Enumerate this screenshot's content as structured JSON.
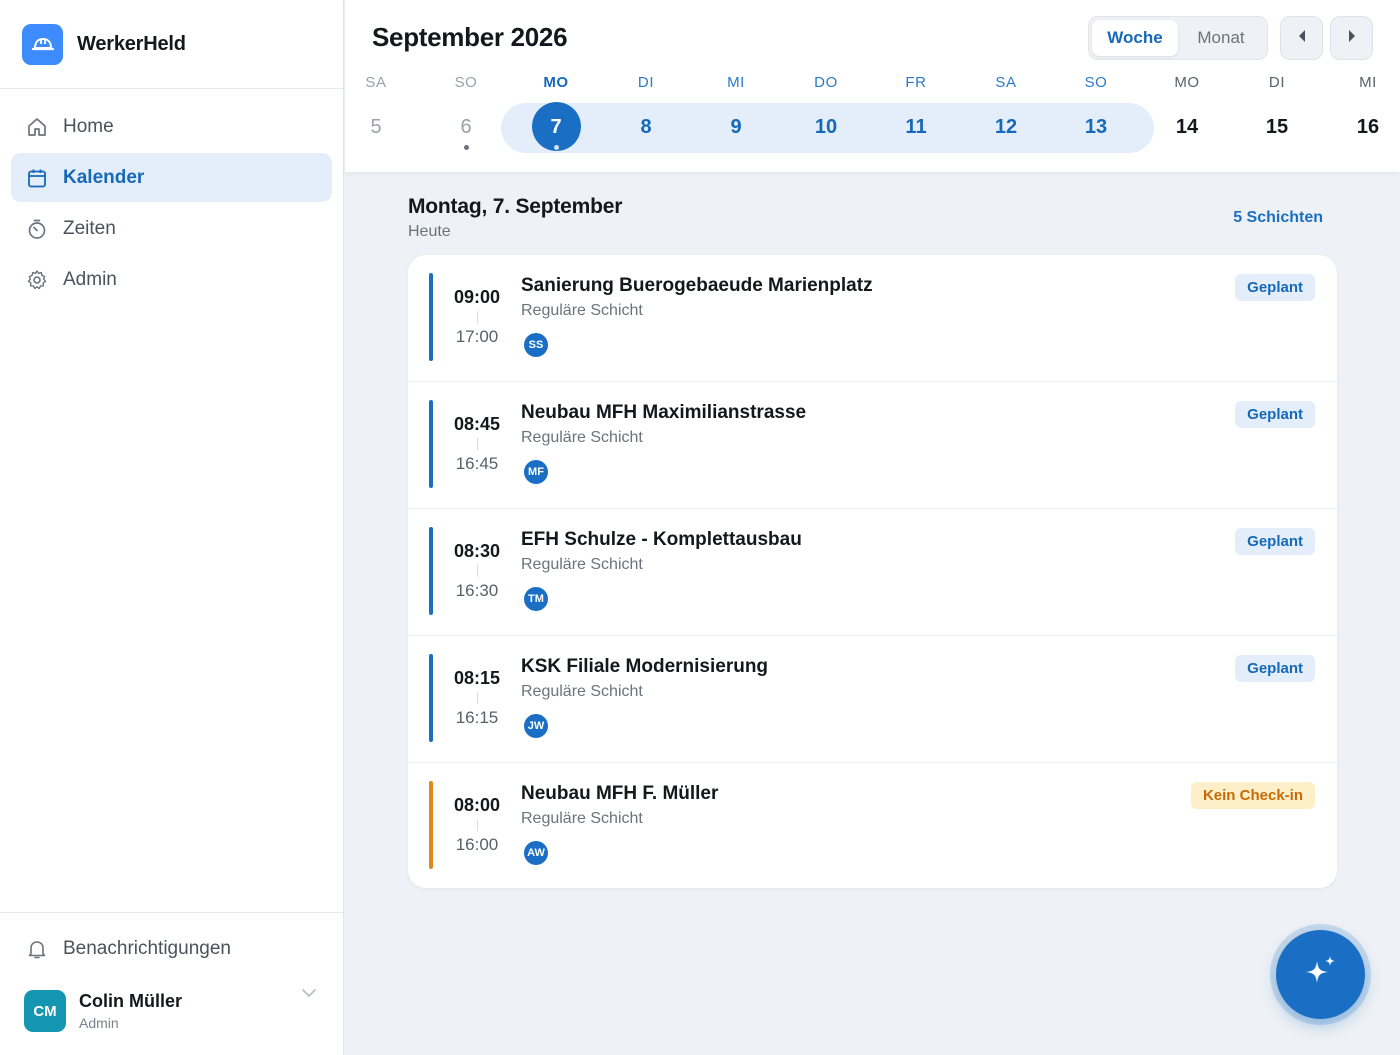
{
  "app": {
    "name": "WerkerHeld",
    "logo_icon": "hard-hat-icon",
    "accent": "#1a6fc4"
  },
  "sidebar": {
    "items": [
      {
        "label": "Home",
        "icon": "home-icon",
        "active": false
      },
      {
        "label": "Kalender",
        "icon": "calendar-icon",
        "active": true
      },
      {
        "label": "Zeiten",
        "icon": "stopwatch-icon",
        "active": false
      },
      {
        "label": "Admin",
        "icon": "gear-icon",
        "active": false
      }
    ],
    "notifications_label": "Benachrichtigungen",
    "user": {
      "initials": "CM",
      "name": "Colin Müller",
      "role": "Admin"
    }
  },
  "header": {
    "month_title": "September 2026",
    "view_toggle": {
      "week": "Woche",
      "month": "Monat",
      "selected": "Woche"
    },
    "days": [
      {
        "name": "SA",
        "num": "5"
      },
      {
        "name": "SO",
        "num": "6"
      },
      {
        "name": "MO",
        "num": "7"
      },
      {
        "name": "DI",
        "num": "8"
      },
      {
        "name": "MI",
        "num": "9"
      },
      {
        "name": "DO",
        "num": "10"
      },
      {
        "name": "FR",
        "num": "11"
      },
      {
        "name": "SA",
        "num": "12"
      },
      {
        "name": "SO",
        "num": "13"
      },
      {
        "name": "MO",
        "num": "14"
      },
      {
        "name": "DI",
        "num": "15"
      },
      {
        "name": "MI",
        "num": "16"
      }
    ]
  },
  "day_view": {
    "title": "Montag, 7. September",
    "subtitle": "Heute",
    "shift_count": "5 Schichten",
    "shifts": [
      {
        "start": "09:00",
        "end": "17:00",
        "title": "Sanierung Buerogebaeude Marienplatz",
        "type": "Reguläre Schicht",
        "initials": "SS",
        "status": "Geplant"
      },
      {
        "start": "08:45",
        "end": "16:45",
        "title": "Neubau MFH Maximilianstrasse",
        "type": "Reguläre Schicht",
        "initials": "MF",
        "status": "Geplant"
      },
      {
        "start": "08:30",
        "end": "16:30",
        "title": "EFH Schulze - Komplettausbau",
        "type": "Reguläre Schicht",
        "initials": "TM",
        "status": "Geplant"
      },
      {
        "start": "08:15",
        "end": "16:15",
        "title": "KSK Filiale Modernisierung",
        "type": "Reguläre Schicht",
        "initials": "JW",
        "status": "Geplant"
      },
      {
        "start": "08:00",
        "end": "16:00",
        "title": "Neubau MFH F. Müller",
        "type": "Reguläre Schicht",
        "initials": "AW",
        "status": "Kein Check-in"
      }
    ]
  },
  "fab_icon": "sparkles-icon"
}
